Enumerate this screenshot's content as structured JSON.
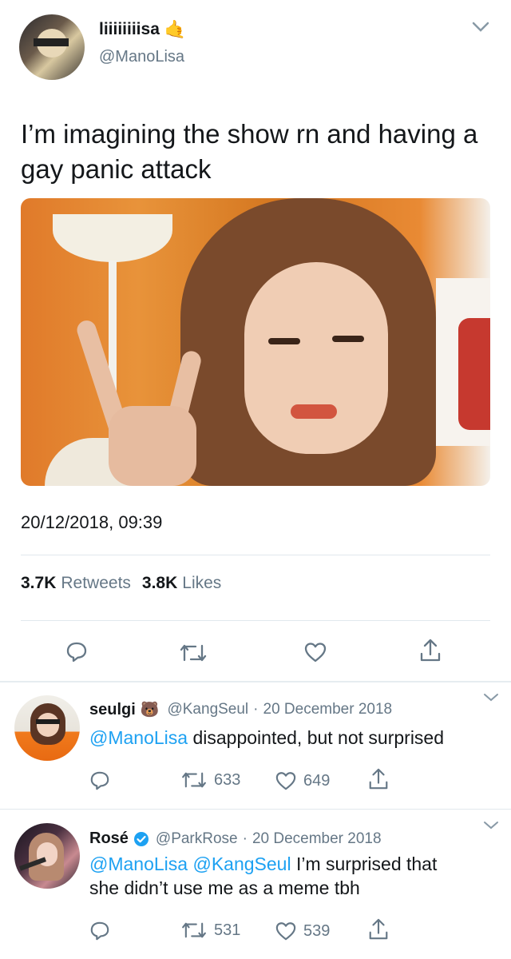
{
  "tweet": {
    "display_name": "liiiiiiiisa",
    "handle": "@ManoLisa",
    "text": "I’m imagining the show rn and having a gay panic attack",
    "timestamp": "20/12/2018, 09:39",
    "retweets_count": "3.7K",
    "retweets_label": "Retweets",
    "likes_count": "3.8K",
    "likes_label": "Likes",
    "name_emoji": "🤙"
  },
  "replies": [
    {
      "display_name": "seulgi",
      "name_emoji": "🐻",
      "handle": "@KangSeul",
      "separator": "·",
      "date": "20 December 2018",
      "mention": "@ManoLisa",
      "text": "disappointed, but not surprised",
      "retweets": "633",
      "likes": "649"
    },
    {
      "display_name": "Rosé",
      "verified": true,
      "handle": "@ParkRose",
      "separator": "·",
      "date": "20 December 2018",
      "mention1": "@ManoLisa",
      "mention2": "@KangSeul",
      "text_line1": "I’m surprised that",
      "text_line2": "she didn’t use me as a meme tbh",
      "retweets": "531",
      "likes": "539"
    }
  ],
  "colors": {
    "link": "#1da1f2",
    "muted": "#657786",
    "divider": "#e1e8ed"
  }
}
